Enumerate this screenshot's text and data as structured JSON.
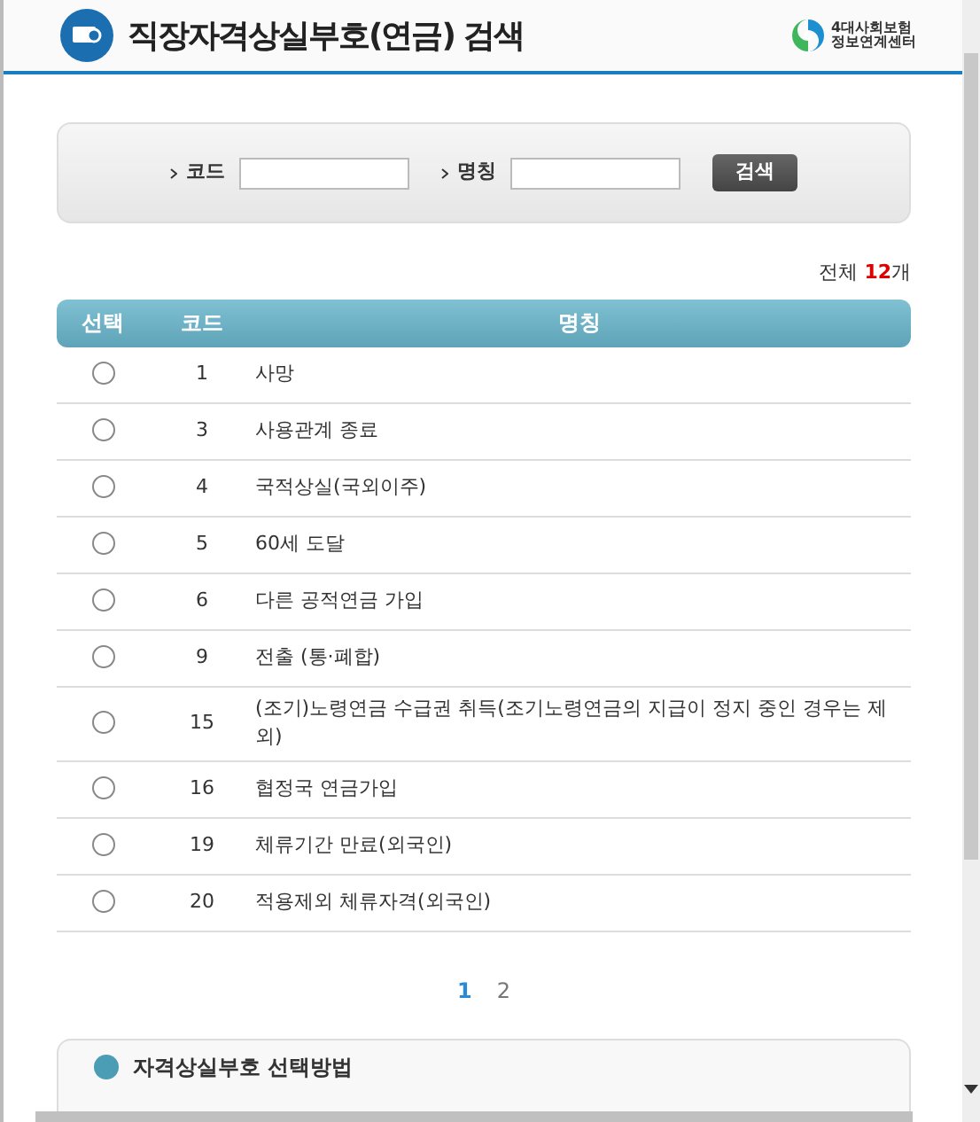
{
  "header": {
    "title": "직장자격상실부호(연금) 검색",
    "logo_text": [
      "4대사회보험",
      "정보연계센터"
    ]
  },
  "search": {
    "fields": [
      {
        "label": "코드"
      },
      {
        "label": "명칭"
      }
    ],
    "button": "검색"
  },
  "total": {
    "prefix": "전체 ",
    "count": "12",
    "suffix": "개"
  },
  "table": {
    "columns": [
      "선택",
      "코드",
      "명칭"
    ],
    "rows": [
      {
        "code": "1",
        "name": "사망",
        "selected": false
      },
      {
        "code": "3",
        "name": "사용관계 종료",
        "selected": false
      },
      {
        "code": "4",
        "name": "국적상실(국외이주)",
        "selected": false
      },
      {
        "code": "5",
        "name": "60세 도달",
        "selected": false
      },
      {
        "code": "6",
        "name": "다른 공적연금 가입",
        "selected": false
      },
      {
        "code": "9",
        "name": "전출 (통·폐합)",
        "selected": false
      },
      {
        "code": "15",
        "name": "(조기)노령연금 수급권 취득(조기노령연금의 지급이 정지 중인 경우는 제외)",
        "selected": false
      },
      {
        "code": "16",
        "name": "협정국 연금가입",
        "selected": false
      },
      {
        "code": "19",
        "name": "체류기간 만료(외국인)",
        "selected": false
      },
      {
        "code": "20",
        "name": "적용제외 체류자격(외국인)",
        "selected": false
      }
    ]
  },
  "pagination": [
    {
      "label": "1",
      "selected": true
    },
    {
      "label": "2",
      "selected": false
    }
  ],
  "help": {
    "title": "자격상실부호 선택방법"
  }
}
